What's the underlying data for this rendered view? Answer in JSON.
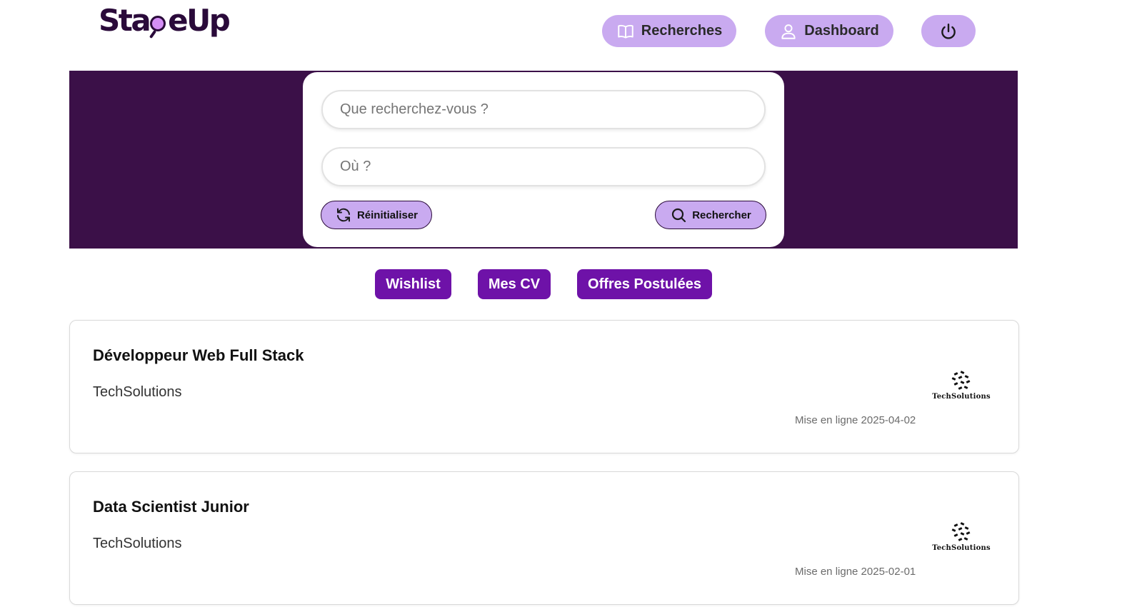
{
  "header": {
    "logo_text_before": "Sta",
    "logo_text_after": "eUp",
    "nav": {
      "recherches_label": "Recherches",
      "dashboard_label": "Dashboard"
    }
  },
  "search": {
    "what_placeholder": "Que recherchez-vous ?",
    "where_placeholder": "Où ?",
    "reset_label": "Réinitialiser",
    "search_label": "Rechercher"
  },
  "tabs": {
    "wishlist": "Wishlist",
    "cv": "Mes CV",
    "offers": "Offres Postulées"
  },
  "offers": [
    {
      "title": "Développeur Web Full Stack",
      "company": "TechSolutions",
      "logo_text": "TechSolutions",
      "date": "Mise en ligne 2025-04-02"
    },
    {
      "title": "Data Scientist Junior",
      "company": "TechSolutions",
      "logo_text": "TechSolutions",
      "date": "Mise en ligne 2025-02-01"
    }
  ],
  "colors": {
    "hero_bg": "#3b1048",
    "nav_button_bg": "#c9aaf0",
    "tab_bg": "#6e12a8",
    "logo_accent": "#d48ef5"
  },
  "icons": {
    "recherches": "book-icon",
    "dashboard": "user-icon",
    "power": "power-icon",
    "reset": "refresh-icon",
    "search": "search-icon"
  }
}
